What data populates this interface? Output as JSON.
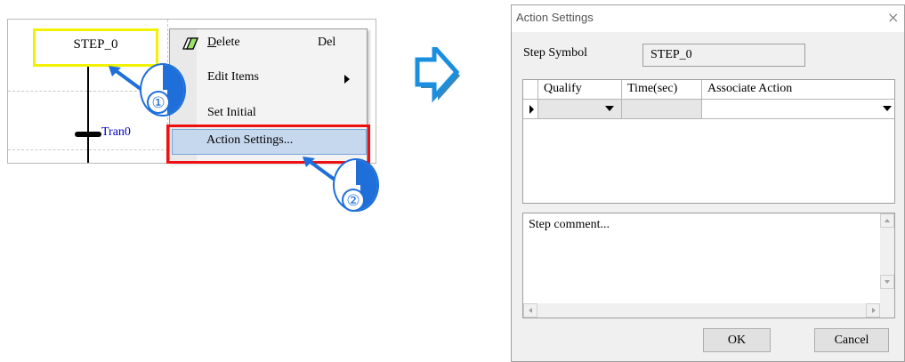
{
  "editor": {
    "step_label": "STEP_0",
    "transition_label": "Tran0"
  },
  "context_menu": {
    "items": [
      {
        "label_first": "D",
        "label_rest": "elete",
        "shortcut": "Del"
      },
      {
        "label": "Edit Items"
      },
      {
        "label": "Set Initial"
      },
      {
        "label": "Action Settings..."
      }
    ]
  },
  "callouts": {
    "first": "①",
    "second": "②"
  },
  "dialog": {
    "title": "Action Settings",
    "close_glyph": "×",
    "step_symbol_label": "Step Symbol",
    "step_symbol_value": "STEP_0",
    "table": {
      "columns": [
        "Qualify",
        "Time(sec)",
        "Associate Action"
      ],
      "rows": [
        {
          "qualify": "",
          "time": "",
          "action": ""
        }
      ]
    },
    "comment_placeholder": "Step comment...",
    "ok_label": "OK",
    "cancel_label": "Cancel"
  },
  "colors": {
    "step_border": "#f2f200",
    "highlight_red": "#ee1111",
    "callout_blue": "#1e6fd9",
    "transition_text": "#0000cc"
  }
}
